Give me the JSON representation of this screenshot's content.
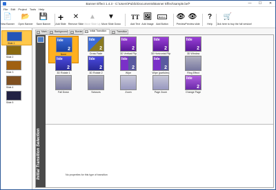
{
  "window": {
    "title": "Banner Effect 1.4.3 - C:\\Users\\Public\\Documents\\Banner Effect\\sample.bef*",
    "minimize": "—",
    "maximize": "☐",
    "close": "✕"
  },
  "menu": [
    "File",
    "Edit",
    "Project",
    "Tools",
    "Help"
  ],
  "toolbar": [
    {
      "label": "New Banner",
      "icon": "new-banner-icon",
      "glyph": "📄",
      "enabled": true
    },
    {
      "label": "Open Banner",
      "icon": "open-folder-icon",
      "glyph": "📂",
      "enabled": true
    },
    {
      "label": "Save Banner",
      "icon": "save-icon",
      "glyph": "💾",
      "enabled": true
    },
    {
      "label": "Add Slide",
      "icon": "plus-icon",
      "glyph": "+",
      "enabled": true
    },
    {
      "label": "Remove Slide",
      "icon": "close-icon",
      "glyph": "✕",
      "enabled": true
    },
    {
      "label": "Move Slide Up",
      "icon": "arrow-up-icon",
      "glyph": "▲",
      "enabled": false
    },
    {
      "label": "Move Slide Down",
      "icon": "arrow-down-icon",
      "glyph": "▼",
      "enabled": true
    },
    {
      "label": "Add Text",
      "icon": "text-icon",
      "glyph": "TT",
      "enabled": true
    },
    {
      "label": "Add Image",
      "icon": "image-icon",
      "glyph": "🖼",
      "enabled": true
    },
    {
      "label": "Add Button",
      "icon": "button-icon",
      "glyph": "Button",
      "enabled": true
    },
    {
      "label": "Preview",
      "icon": "eye-icon",
      "glyph": "👁",
      "enabled": true
    },
    {
      "label": "Preview slide",
      "icon": "eye-icon",
      "glyph": "👁",
      "enabled": true
    },
    {
      "label": "Help",
      "icon": "question-icon",
      "glyph": "?",
      "enabled": true
    },
    {
      "label": "Click here to buy the full version!",
      "icon": "cart-icon",
      "glyph": "🛒",
      "enabled": true
    }
  ],
  "slides": [
    {
      "label": "Slide 1",
      "selected": true,
      "color": "#2455b8"
    },
    {
      "label": "Slide 2",
      "selected": false,
      "color": "#8a6a10"
    },
    {
      "label": "Slide 3",
      "selected": false,
      "color": "#a06010"
    },
    {
      "label": "Slide 4",
      "selected": false,
      "color": "#805020"
    },
    {
      "label": "Slide 5",
      "selected": false,
      "color": "#222244"
    }
  ],
  "tabs": [
    {
      "label": "Main",
      "active": false
    },
    {
      "label": "Background",
      "active": false
    },
    {
      "label": "Border",
      "active": false
    },
    {
      "label": "Initial Transition",
      "active": true
    },
    {
      "label": "Transition",
      "active": false
    }
  ],
  "section_title": "Initial Transition Selection",
  "transitions": [
    {
      "label": "None",
      "selected": true,
      "style": "none"
    },
    {
      "label": "Cross Fade",
      "selected": false,
      "style": "fade"
    },
    {
      "label": "3D Vertical Flip",
      "selected": false,
      "style": "purple"
    },
    {
      "label": "3D Horizontal Flip",
      "selected": false,
      "style": "purple"
    },
    {
      "label": "3D Window",
      "selected": false,
      "style": "purple"
    },
    {
      "label": "3D Rotate 1",
      "selected": false,
      "style": "blue"
    },
    {
      "label": "3D Rotate 2",
      "selected": false,
      "style": "blue"
    },
    {
      "label": "Wipe",
      "selected": false,
      "style": "wipe"
    },
    {
      "label": "Wipe (particles)",
      "selected": false,
      "style": "wipe"
    },
    {
      "label": "Ring Effect",
      "selected": false,
      "style": "gray"
    },
    {
      "label": "Fall Down",
      "selected": false,
      "style": "gray"
    },
    {
      "label": "Scissors",
      "selected": false,
      "style": "gray"
    },
    {
      "label": "Zoom",
      "selected": false,
      "style": "grayblue"
    },
    {
      "label": "Page Zoom",
      "selected": false,
      "style": "grayblue"
    },
    {
      "label": "Change Page",
      "selected": false,
      "style": "purple2"
    }
  ],
  "thumb_number": "2",
  "thumb_word": "lide",
  "properties_message": "No properties for this type of transition"
}
